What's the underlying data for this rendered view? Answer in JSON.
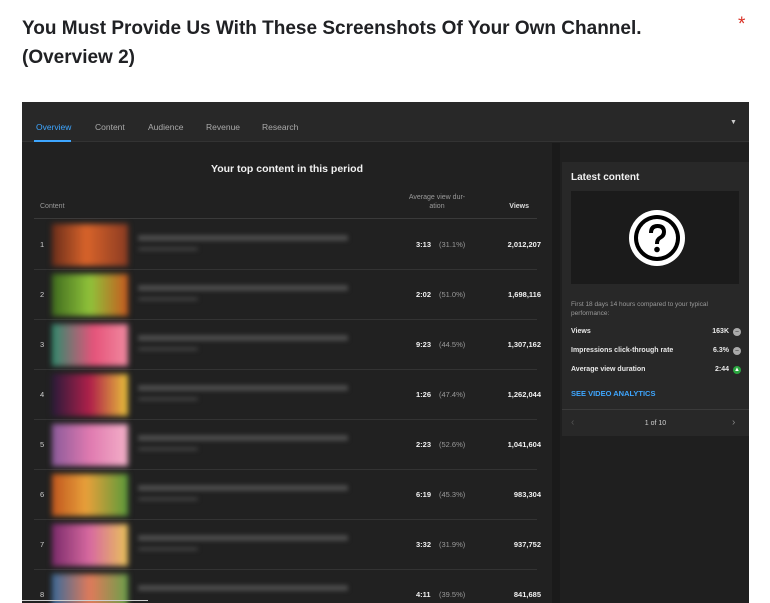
{
  "question": {
    "text": "You Must Provide Us With These Screenshots Of Your Own Channel. (Overview 2)",
    "required_mark": "*"
  },
  "studio": {
    "tabs": [
      {
        "label": "Overview",
        "active": true
      },
      {
        "label": "Content",
        "active": false
      },
      {
        "label": "Audience",
        "active": false
      },
      {
        "label": "Revenue",
        "active": false
      },
      {
        "label": "Research",
        "active": false
      }
    ],
    "top_content": {
      "title": "Your top content in this period",
      "columns": {
        "content": "Content",
        "avg_view_duration": "Average view dur-ation",
        "views": "Views"
      },
      "rows": [
        {
          "index": "1",
          "duration": "3:13",
          "percent": "(31.1%)",
          "views": "2,012,207"
        },
        {
          "index": "2",
          "duration": "2:02",
          "percent": "(51.0%)",
          "views": "1,698,116"
        },
        {
          "index": "3",
          "duration": "9:23",
          "percent": "(44.5%)",
          "views": "1,307,162"
        },
        {
          "index": "4",
          "duration": "1:26",
          "percent": "(47.4%)",
          "views": "1,262,044"
        },
        {
          "index": "5",
          "duration": "2:23",
          "percent": "(52.6%)",
          "views": "1,041,604"
        },
        {
          "index": "6",
          "duration": "6:19",
          "percent": "(45.3%)",
          "views": "983,304"
        },
        {
          "index": "7",
          "duration": "3:32",
          "percent": "(31.9%)",
          "views": "937,752"
        },
        {
          "index": "8",
          "duration": "4:11",
          "percent": "(39.5%)",
          "views": "841,685"
        }
      ]
    },
    "latest_content": {
      "title": "Latest content",
      "performance_text": "First 18 days 14 hours compared to your typical performance:",
      "metrics": [
        {
          "label": "Views",
          "value": "163K",
          "status": "neutral"
        },
        {
          "label": "Impressions click-through rate",
          "value": "6.3%",
          "status": "neutral"
        },
        {
          "label": "Average view duration",
          "value": "2:44",
          "status": "up"
        }
      ],
      "link": "SEE VIDEO ANALYTICS",
      "pager": "1 of 10"
    }
  },
  "colors": {
    "accent": "#3ea6ff",
    "required": "#d93025",
    "up": "#2ba640"
  }
}
